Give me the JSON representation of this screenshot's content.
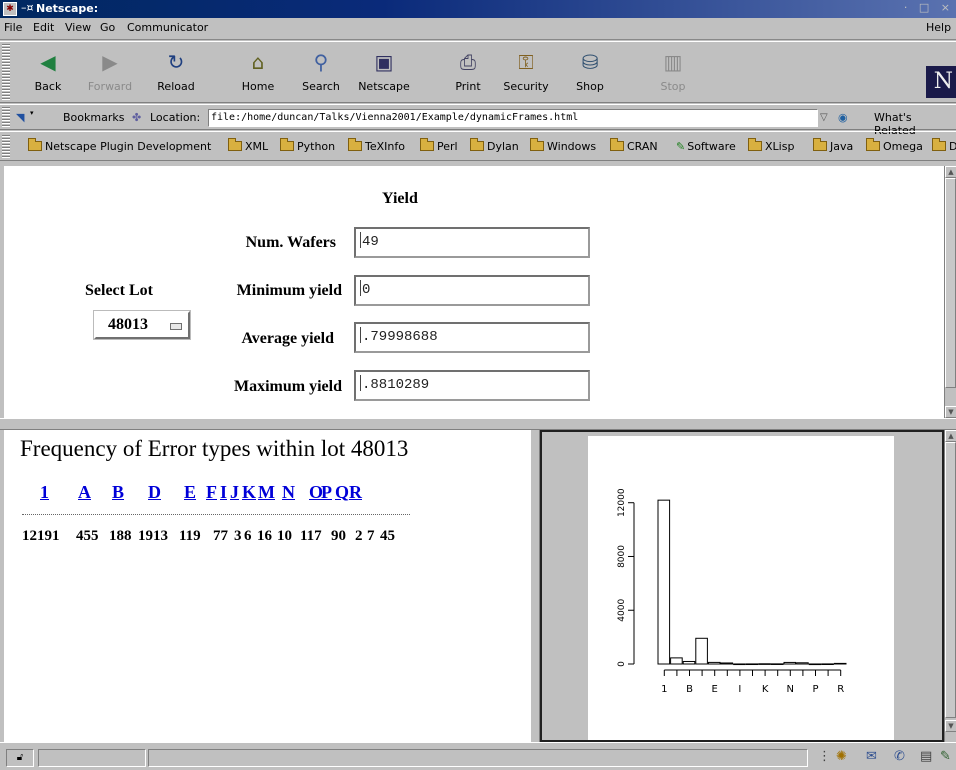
{
  "window": {
    "title": "Netscape:",
    "app_icon": "netscape-icon"
  },
  "menu": [
    "File",
    "Edit",
    "View",
    "Go",
    "Communicator",
    "Help"
  ],
  "toolbar": [
    {
      "label": "Back",
      "icon": "back-arrow-icon",
      "enabled": true
    },
    {
      "label": "Forward",
      "icon": "forward-arrow-icon",
      "enabled": false
    },
    {
      "label": "Reload",
      "icon": "reload-icon",
      "enabled": true
    },
    {
      "label": "Home",
      "icon": "home-icon",
      "enabled": true
    },
    {
      "label": "Search",
      "icon": "search-icon",
      "enabled": true
    },
    {
      "label": "Netscape",
      "icon": "netscape-icon",
      "enabled": true
    },
    {
      "label": "Print",
      "icon": "print-icon",
      "enabled": true
    },
    {
      "label": "Security",
      "icon": "lock-icon",
      "enabled": true
    },
    {
      "label": "Shop",
      "icon": "shop-icon",
      "enabled": true
    },
    {
      "label": "Stop",
      "icon": "stop-icon",
      "enabled": false
    }
  ],
  "brand_letter": "N",
  "location": {
    "bookmarks_label": "Bookmarks",
    "location_label": "Location:",
    "url": "file:/home/duncan/Talks/Vienna2001/Example/dynamicFrames.html",
    "whats_related": "What's Related"
  },
  "personal_toolbar": [
    "Netscape Plugin Development",
    "XML",
    "Python",
    "TeXInfo",
    "Perl",
    "Dylan",
    "Windows",
    "CRAN",
    "Software",
    "XLisp",
    "Java",
    "Omega",
    "D"
  ],
  "form": {
    "heading": "Yield",
    "select_lot_label": "Select Lot",
    "lot_value": "48013",
    "num_wafers_label": "Num. Wafers",
    "num_wafers_value": "49",
    "min_yield_label": "Minimum yield",
    "min_yield_value": "0",
    "avg_yield_label": "Average yield",
    "avg_yield_value": ".79998688",
    "max_yield_label": "Maximum yield",
    "max_yield_value": ".8810289"
  },
  "frequency": {
    "heading": "Frequency of Error types within lot 48013",
    "types": [
      "1",
      "A",
      "B",
      "D",
      "E",
      "F",
      "I",
      "J",
      "K",
      "M",
      "N",
      "O",
      "P",
      "Q",
      "R"
    ],
    "counts": [
      "12191",
      "455",
      "188",
      "1913",
      "119",
      "77",
      "3",
      "6",
      "16",
      "10",
      "117",
      "90",
      "2",
      "7",
      "45"
    ]
  },
  "chart_data": {
    "type": "bar",
    "categories": [
      "1",
      "A",
      "B",
      "D",
      "E",
      "F",
      "I",
      "J",
      "K",
      "M",
      "N",
      "O",
      "P",
      "Q",
      "R"
    ],
    "values": [
      12191,
      455,
      188,
      1913,
      119,
      77,
      3,
      6,
      16,
      10,
      117,
      90,
      2,
      7,
      45
    ],
    "x_tick_labels": [
      "1",
      "B",
      "E",
      "I",
      "K",
      "N",
      "P",
      "R"
    ],
    "y_ticks": [
      0,
      4000,
      8000,
      12000
    ],
    "ylim": [
      0,
      12500
    ],
    "title": "",
    "xlabel": "",
    "ylabel": "",
    "grid": false
  }
}
